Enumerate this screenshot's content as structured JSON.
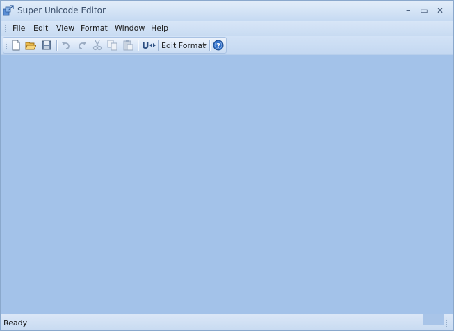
{
  "window": {
    "title": "Super Unicode Editor",
    "controls": {
      "minimize": "–",
      "maximize": "▭",
      "close": "✕"
    }
  },
  "menu": {
    "items": [
      "File",
      "Edit",
      "View",
      "Format",
      "Window",
      "Help"
    ]
  },
  "toolbar": {
    "buttons": [
      {
        "name": "new-document",
        "icon": "new-document-icon",
        "enabled": true
      },
      {
        "name": "open-folder",
        "icon": "open-folder-icon",
        "enabled": true
      },
      {
        "name": "save",
        "icon": "save-icon",
        "enabled": true
      },
      {
        "name": "undo",
        "icon": "undo-icon",
        "enabled": false
      },
      {
        "name": "redo",
        "icon": "redo-icon",
        "enabled": false
      },
      {
        "name": "cut",
        "icon": "cut-icon",
        "enabled": false
      },
      {
        "name": "copy",
        "icon": "copy-icon",
        "enabled": false
      },
      {
        "name": "paste",
        "icon": "paste-icon",
        "enabled": false
      },
      {
        "name": "unicode",
        "icon": "unicode-icon",
        "enabled": true
      },
      {
        "name": "help",
        "icon": "help-icon",
        "enabled": true
      }
    ],
    "edit_format_label": "Edit Format",
    "unicode_label": "U"
  },
  "status": {
    "text": "Ready"
  },
  "colors": {
    "client_background": "#a3c2e9",
    "chrome_background": "#c7dbf2",
    "accent": "#2f6fc9"
  }
}
